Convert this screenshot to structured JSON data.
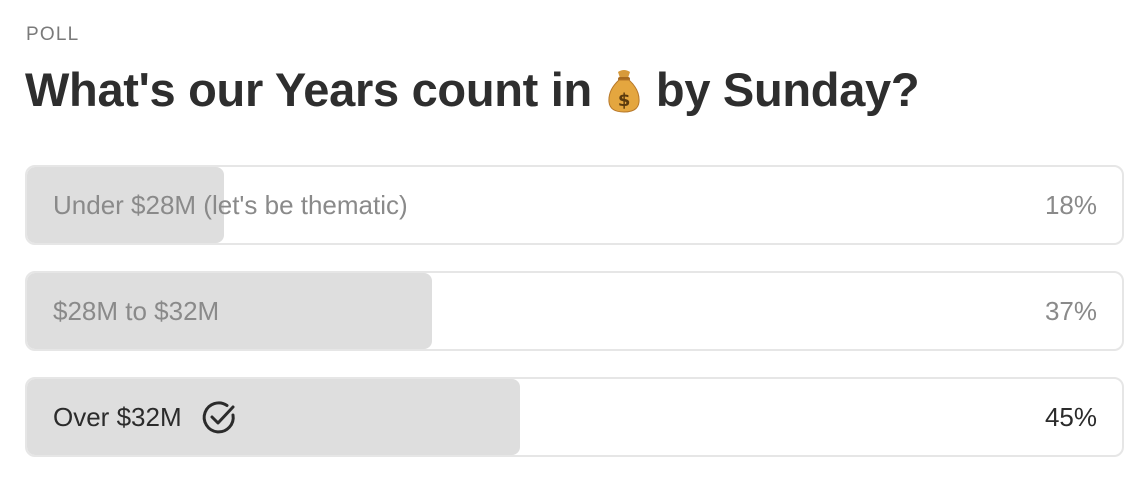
{
  "poll": {
    "label": "POLL",
    "title_before": "What's our Years count in",
    "title_emoji": "money-bag-icon",
    "title_after": "by Sunday?",
    "options": [
      {
        "label": "Under $28M (let's be thematic)",
        "percent_text": "18%",
        "percent": 18,
        "selected": false
      },
      {
        "label": "$28M to $32M",
        "percent_text": "37%",
        "percent": 37,
        "selected": false
      },
      {
        "label": "Over $32M",
        "percent_text": "45%",
        "percent": 45,
        "selected": true
      }
    ]
  },
  "colors": {
    "fill": "#dedede",
    "border": "#e6e6e6",
    "muted_text": "#8a8a8a",
    "strong_text": "#2b2b2b"
  }
}
